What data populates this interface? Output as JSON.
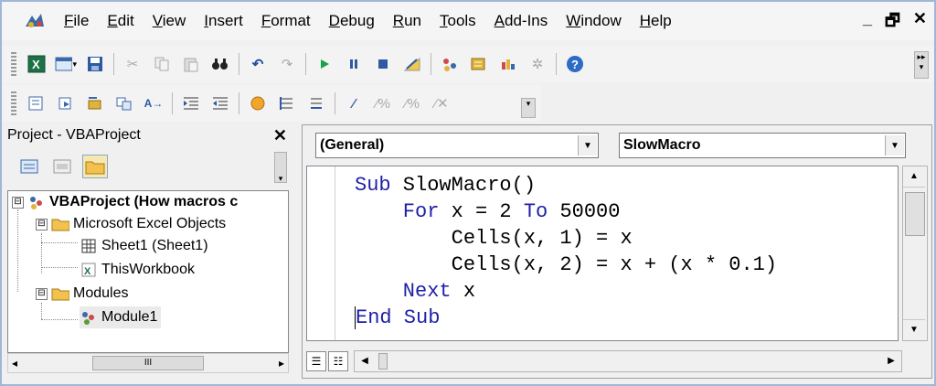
{
  "menubar": {
    "items": [
      "File",
      "Edit",
      "View",
      "Insert",
      "Format",
      "Debug",
      "Run",
      "Tools",
      "Add-Ins",
      "Window",
      "Help"
    ],
    "window_controls": [
      "_",
      "🗗",
      "✕"
    ]
  },
  "toolbar_standard": {
    "icons": [
      "excel-icon",
      "insert-userform-icon",
      "save-icon",
      "cut-icon",
      "copy-icon",
      "paste-icon",
      "find-icon",
      "undo-icon",
      "redo-icon",
      "run-icon",
      "break-icon",
      "reset-icon",
      "design-mode-icon",
      "project-explorer-icon",
      "properties-icon",
      "object-browser-icon",
      "toolbox-icon",
      "help-icon"
    ]
  },
  "toolbar_edit": {
    "icons": [
      "list-properties-icon",
      "list-constants-icon",
      "quick-info-icon",
      "parameter-info-icon",
      "complete-word-icon",
      "indent-icon",
      "outdent-icon",
      "toggle-breakpoint-icon",
      "comment-block-icon",
      "uncomment-block-icon",
      "toggle-bookmark-icon",
      "next-bookmark-icon",
      "previous-bookmark-icon",
      "clear-bookmarks-icon"
    ]
  },
  "project": {
    "title": "Project - VBAProject",
    "close": "✕",
    "tree": {
      "root": "VBAProject (How macros c",
      "excel_objects": "Microsoft Excel Objects",
      "sheet1": "Sheet1 (Sheet1)",
      "thisworkbook": "ThisWorkbook",
      "modules": "Modules",
      "module1": "Module1"
    },
    "expanders": [
      "⊟",
      "⊟",
      "⊟"
    ],
    "scroll_thumb": "III"
  },
  "code": {
    "object_combo": "(General)",
    "procedure_combo": "SlowMacro",
    "lines": [
      {
        "kw": "Sub",
        "rest": " SlowMacro()"
      },
      {
        "kw": "    For",
        "rest": " x = 2 ",
        "kw2": "To",
        "rest2": " 50000"
      },
      {
        "rest": "        Cells(x, 1) = x"
      },
      {
        "rest": "        Cells(x, 2) = x + (x * 0.1)"
      },
      {
        "kw": "    Next",
        "rest": " x"
      },
      {
        "kw": "End Sub",
        "rest": ""
      }
    ]
  },
  "colors": {
    "keyword": "#1f1fa8",
    "frame_border": "#9fb7d6"
  }
}
